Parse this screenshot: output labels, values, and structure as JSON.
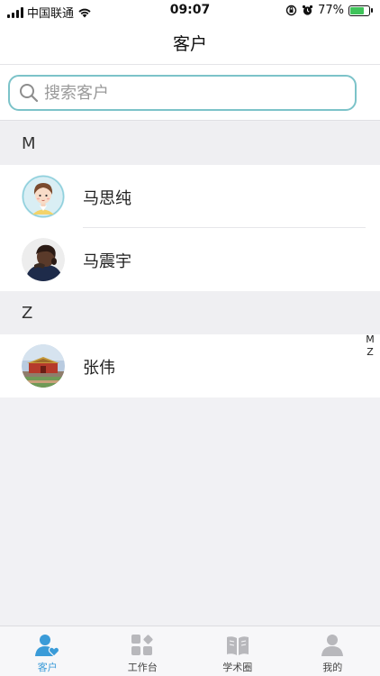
{
  "status_bar": {
    "carrier": "中国联通",
    "time": "09:07",
    "battery": "77%",
    "battery_level": 0.77
  },
  "nav": {
    "title": "客户"
  },
  "search": {
    "placeholder": "搜索客户",
    "value": ""
  },
  "sections": [
    {
      "letter": "M",
      "contacts": [
        {
          "name": "马思纯",
          "avatar": "cartoon-girl-avatar"
        },
        {
          "name": "马震宇",
          "avatar": "photo-person-avatar"
        }
      ]
    },
    {
      "letter": "Z",
      "contacts": [
        {
          "name": "张伟",
          "avatar": "landscape-photo-avatar"
        }
      ]
    }
  ],
  "index_letters": [
    "M",
    "Z"
  ],
  "tabs": [
    {
      "label": "客户",
      "icon": "customer-icon",
      "active": true
    },
    {
      "label": "工作台",
      "icon": "workbench-icon",
      "active": false
    },
    {
      "label": "学术圈",
      "icon": "book-icon",
      "active": false
    },
    {
      "label": "我的",
      "icon": "profile-icon",
      "active": false
    }
  ],
  "colors": {
    "accent": "#3a9bd8",
    "search_border": "#7cc3c9",
    "tab_inactive_icon": "#b8b8bc",
    "battery_fill": "#3fc35a"
  }
}
